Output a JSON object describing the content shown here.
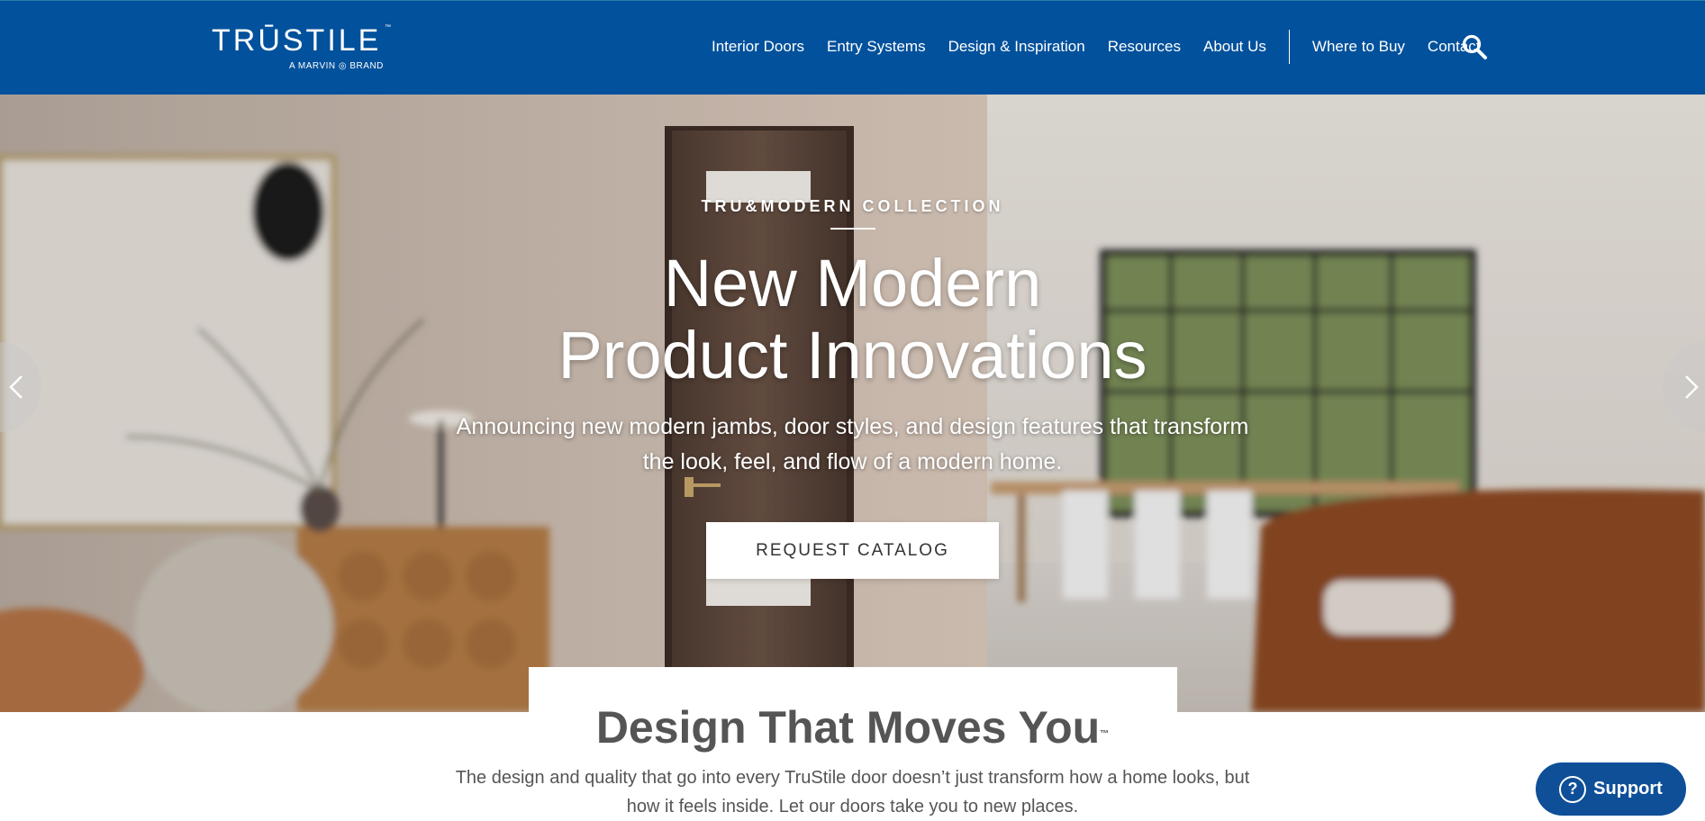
{
  "header": {
    "logo": {
      "wordmark": "TRŪSTILE",
      "tm": "™",
      "tagline": "A MARVIN ◎ BRAND"
    },
    "nav": [
      {
        "label": "Interior Doors"
      },
      {
        "label": "Entry Systems"
      },
      {
        "label": "Design & Inspiration"
      },
      {
        "label": "Resources"
      },
      {
        "label": "About Us"
      },
      {
        "label": "Where to Buy"
      },
      {
        "label": "Contact"
      }
    ],
    "search_icon": "search-icon"
  },
  "hero": {
    "eyebrow": "TRU&MODERN COLLECTION",
    "title_line1": "New Modern",
    "title_line2": "Product Innovations",
    "subtitle_line1": "Announcing new modern jambs, door styles, and design features that transform",
    "subtitle_line2": "the look, feel, and flow of a modern home.",
    "cta_label": "REQUEST CATALOG",
    "prev_icon": "chevron-left-icon",
    "next_icon": "chevron-right-icon"
  },
  "section": {
    "title": "Design That Moves You",
    "title_tm": "™",
    "text_line1": "The design and quality that go into every TruStile door doesn’t just transform how a home looks, but",
    "text_line2": "how it feels inside. Let our doors take you to new places."
  },
  "support": {
    "label": "Support",
    "icon": "question-icon"
  },
  "colors": {
    "brand": "#02519c",
    "support": "#0e4f98"
  }
}
